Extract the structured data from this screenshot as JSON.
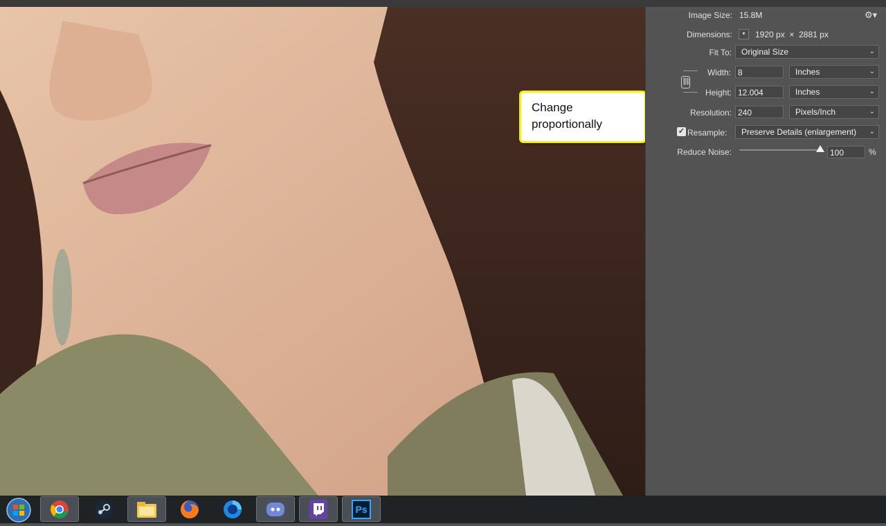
{
  "panel": {
    "image_size_label": "Image Size:",
    "image_size_value": "15.8M",
    "dimensions_label": "Dimensions:",
    "dim_width": "1920",
    "dim_width_unit": "px",
    "dim_times": "×",
    "dim_height": "2881",
    "dim_height_unit": "px",
    "fit_to_label": "Fit To:",
    "fit_to_value": "Original Size",
    "width_label": "Width:",
    "width_value": "8",
    "width_unit": "Inches",
    "height_label": "Height:",
    "height_value": "12.004",
    "height_unit": "Inches",
    "resolution_label": "Resolution:",
    "resolution_value": "240",
    "resolution_unit": "Pixels/Inch",
    "resample_label": "Resample:",
    "resample_checked": true,
    "resample_value": "Preserve Details (enlargement)",
    "reduce_noise_label": "Reduce Noise:",
    "reduce_noise_value": "100",
    "reduce_noise_unit": "%",
    "reduce_noise_level": 100
  },
  "callout": {
    "line1": "Change",
    "line2": "proportionally"
  },
  "icons": {
    "settings": "gear-icon",
    "link": "chain-link-icon",
    "start": "windows-start-icon"
  },
  "taskbar": {
    "apps": [
      "chrome",
      "steam",
      "file-explorer",
      "firefox",
      "firefox-developer",
      "discord",
      "twitch",
      "photoshop"
    ],
    "photoshop_label": "Ps"
  },
  "colors": {
    "callout_border": "#f7f000",
    "arrow": "#f7f000",
    "panel_bg": "#535353",
    "taskbar_bg": "#1f2326"
  }
}
